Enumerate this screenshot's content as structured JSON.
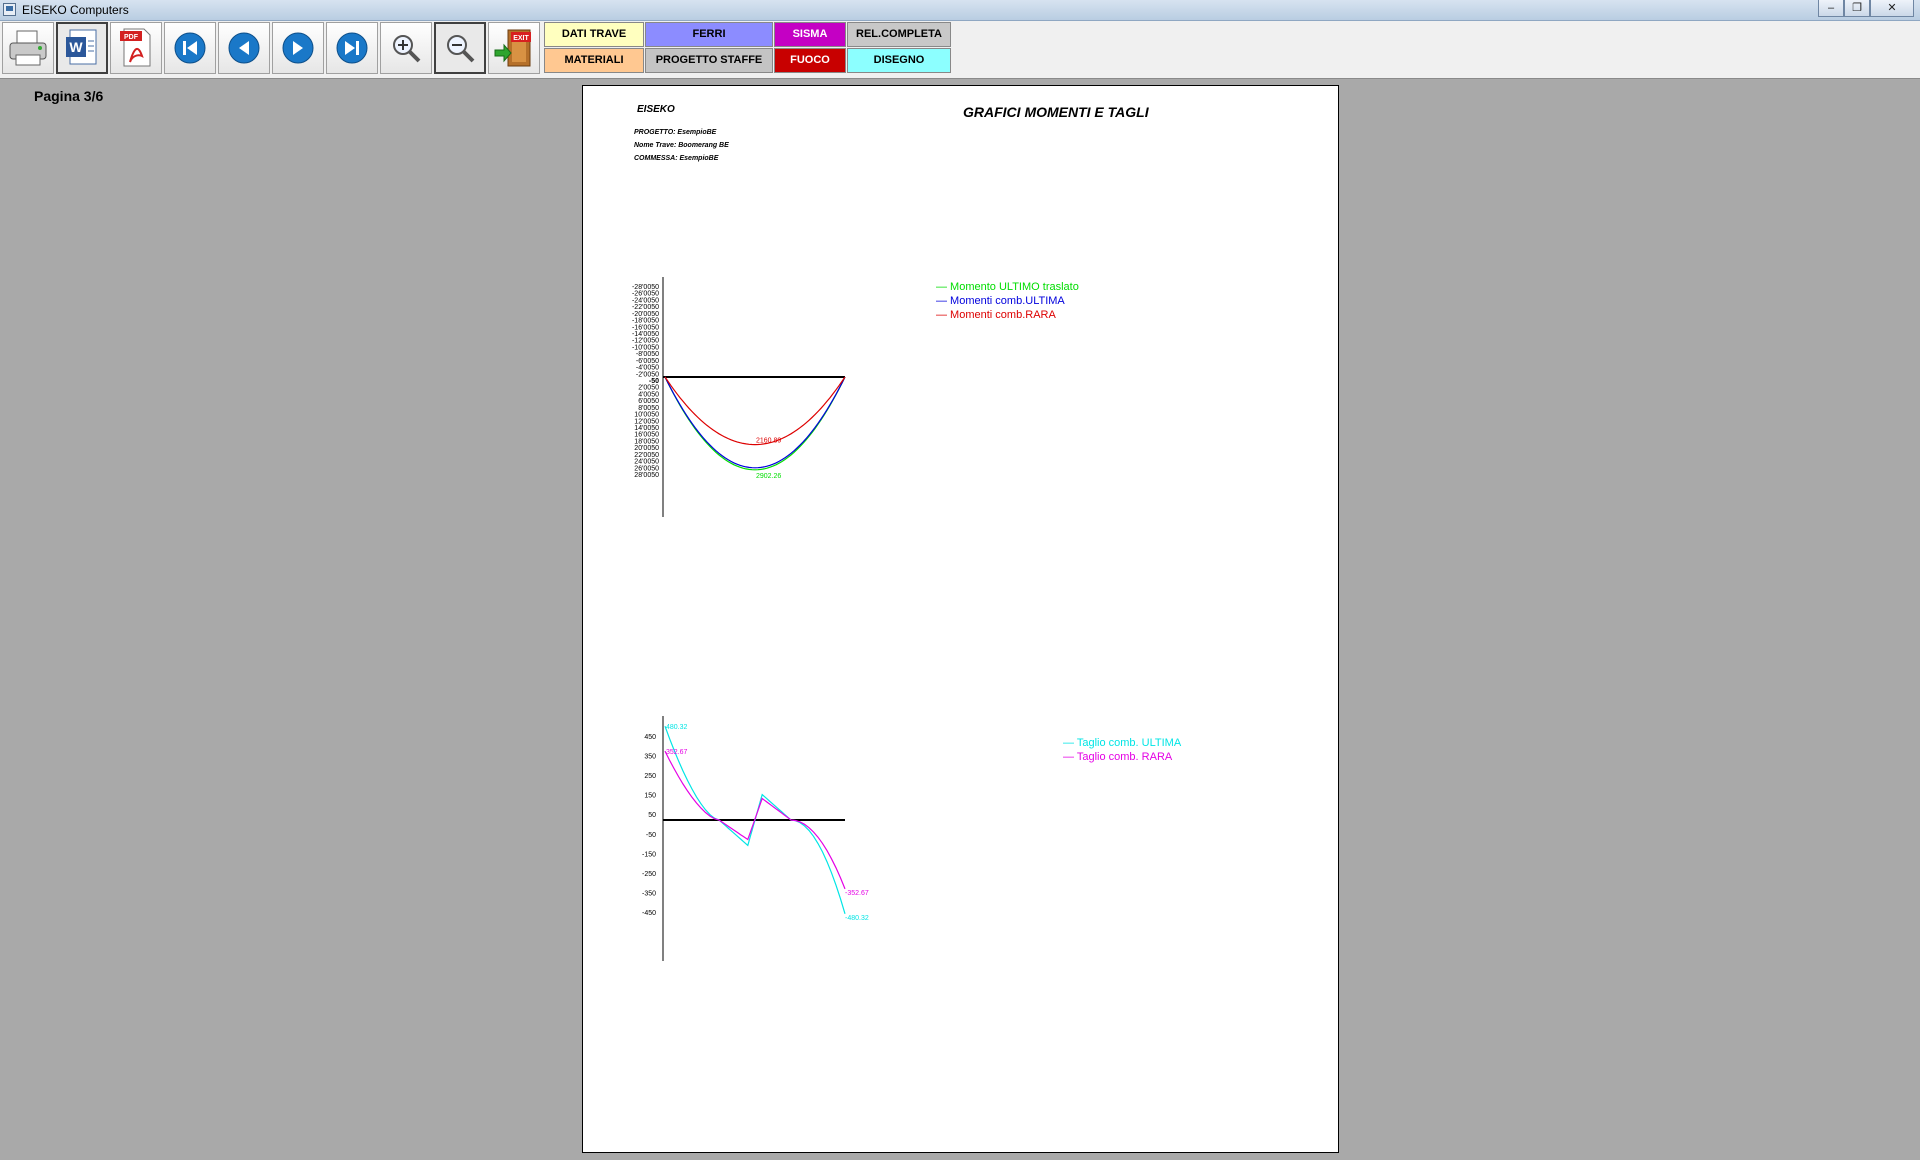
{
  "window": {
    "title": "EISEKO Computers",
    "minimize": "–",
    "maximize": "❐",
    "close": "✕"
  },
  "toolbar": {
    "icons": [
      "printer-icon",
      "word-icon",
      "pdf-icon",
      "first-page-icon",
      "previous-page-icon",
      "next-page-icon",
      "last-page-icon",
      "zoom-in-icon",
      "zoom-out-icon",
      "exit-icon"
    ],
    "pdf_badge": "PDF",
    "exit_badge": "EXIT",
    "labels": {
      "dati_trave": "DATI TRAVE",
      "ferri": "FERRI",
      "sisma": "SISMA",
      "rel_completa": "REL.COMPLETA",
      "materiali": "MATERIALI",
      "progetto_staffe": "PROGETTO STAFFE",
      "fuoco": "FUOCO",
      "disegno": "DISEGNO"
    },
    "label_colors": {
      "dati_trave": "#ffffbf",
      "ferri": "#8c8cff",
      "sisma": "#c400c4",
      "rel_completa": "#c8c8c8",
      "materiali": "#ffc891",
      "progetto_staffe": "#c4c4c4",
      "fuoco": "#c80000",
      "disegno": "#8cffff"
    }
  },
  "page_indicator": "Pagina 3/6",
  "document": {
    "company": "EISEKO",
    "title": "GRAFICI MOMENTI E TAGLI",
    "progetto": "PROGETTO:   EsempioBE",
    "nome_trave": "Nome Trave:   Boomerang BE",
    "commessa": "COMMESSA: EsempioBE"
  },
  "chart_data": [
    {
      "type": "line",
      "title": "",
      "yticks": [
        "-28'0050",
        "-26'0050",
        "-24'0050",
        "-22'0050",
        "-20'0050",
        "-18'0050",
        "-16'0050",
        "-14'0050",
        "-12'0050",
        "-10'0050",
        "-8'0050",
        "-6'0050",
        "-4'0050",
        "-2'0050",
        "-50",
        "2'0050",
        "4'0050",
        "6'0050",
        "8'0050",
        "10'0050",
        "12'0050",
        "14'0050",
        "16'0050",
        "18'0050",
        "20'0050",
        "22'0050",
        "24'0050",
        "26'0050",
        "28'0050"
      ],
      "ylim": [
        -28050,
        28050
      ],
      "y_inverted": true,
      "x": [
        0,
        0.5,
        1
      ],
      "series": [
        {
          "name": "Momento ULTIMO traslato",
          "color": "#00dd00",
          "peak": 2902.26,
          "peak_label": "2902.26"
        },
        {
          "name": "Momenti comb.ULTIMA",
          "color": "#0000dd",
          "peak": 2902.26
        },
        {
          "name": "Momenti comb.RARA",
          "color": "#dd0000",
          "peak": 2160.89,
          "peak_label": "2160.89"
        }
      ]
    },
    {
      "type": "line",
      "title": "",
      "yticks": [
        "450",
        "350",
        "250",
        "150",
        "50",
        "-50",
        "-150",
        "-250",
        "-350",
        "-450"
      ],
      "ylim": [
        -500,
        500
      ],
      "x": [
        0,
        0.3,
        0.46,
        0.54,
        0.7,
        1
      ],
      "series": [
        {
          "name": "Taglio comb. ULTIMA",
          "color": "#00e5e5",
          "values": [
            480.32,
            0,
            -130,
            130,
            0,
            -480.32
          ],
          "start_label": "480.32",
          "end_label": "-480.32"
        },
        {
          "name": "Taglio comb. RARA",
          "color": "#e500e5",
          "values": [
            352.67,
            0,
            -100,
            110,
            0,
            -352.67
          ],
          "start_label": "352.67",
          "end_label": "-352.67"
        }
      ]
    }
  ]
}
